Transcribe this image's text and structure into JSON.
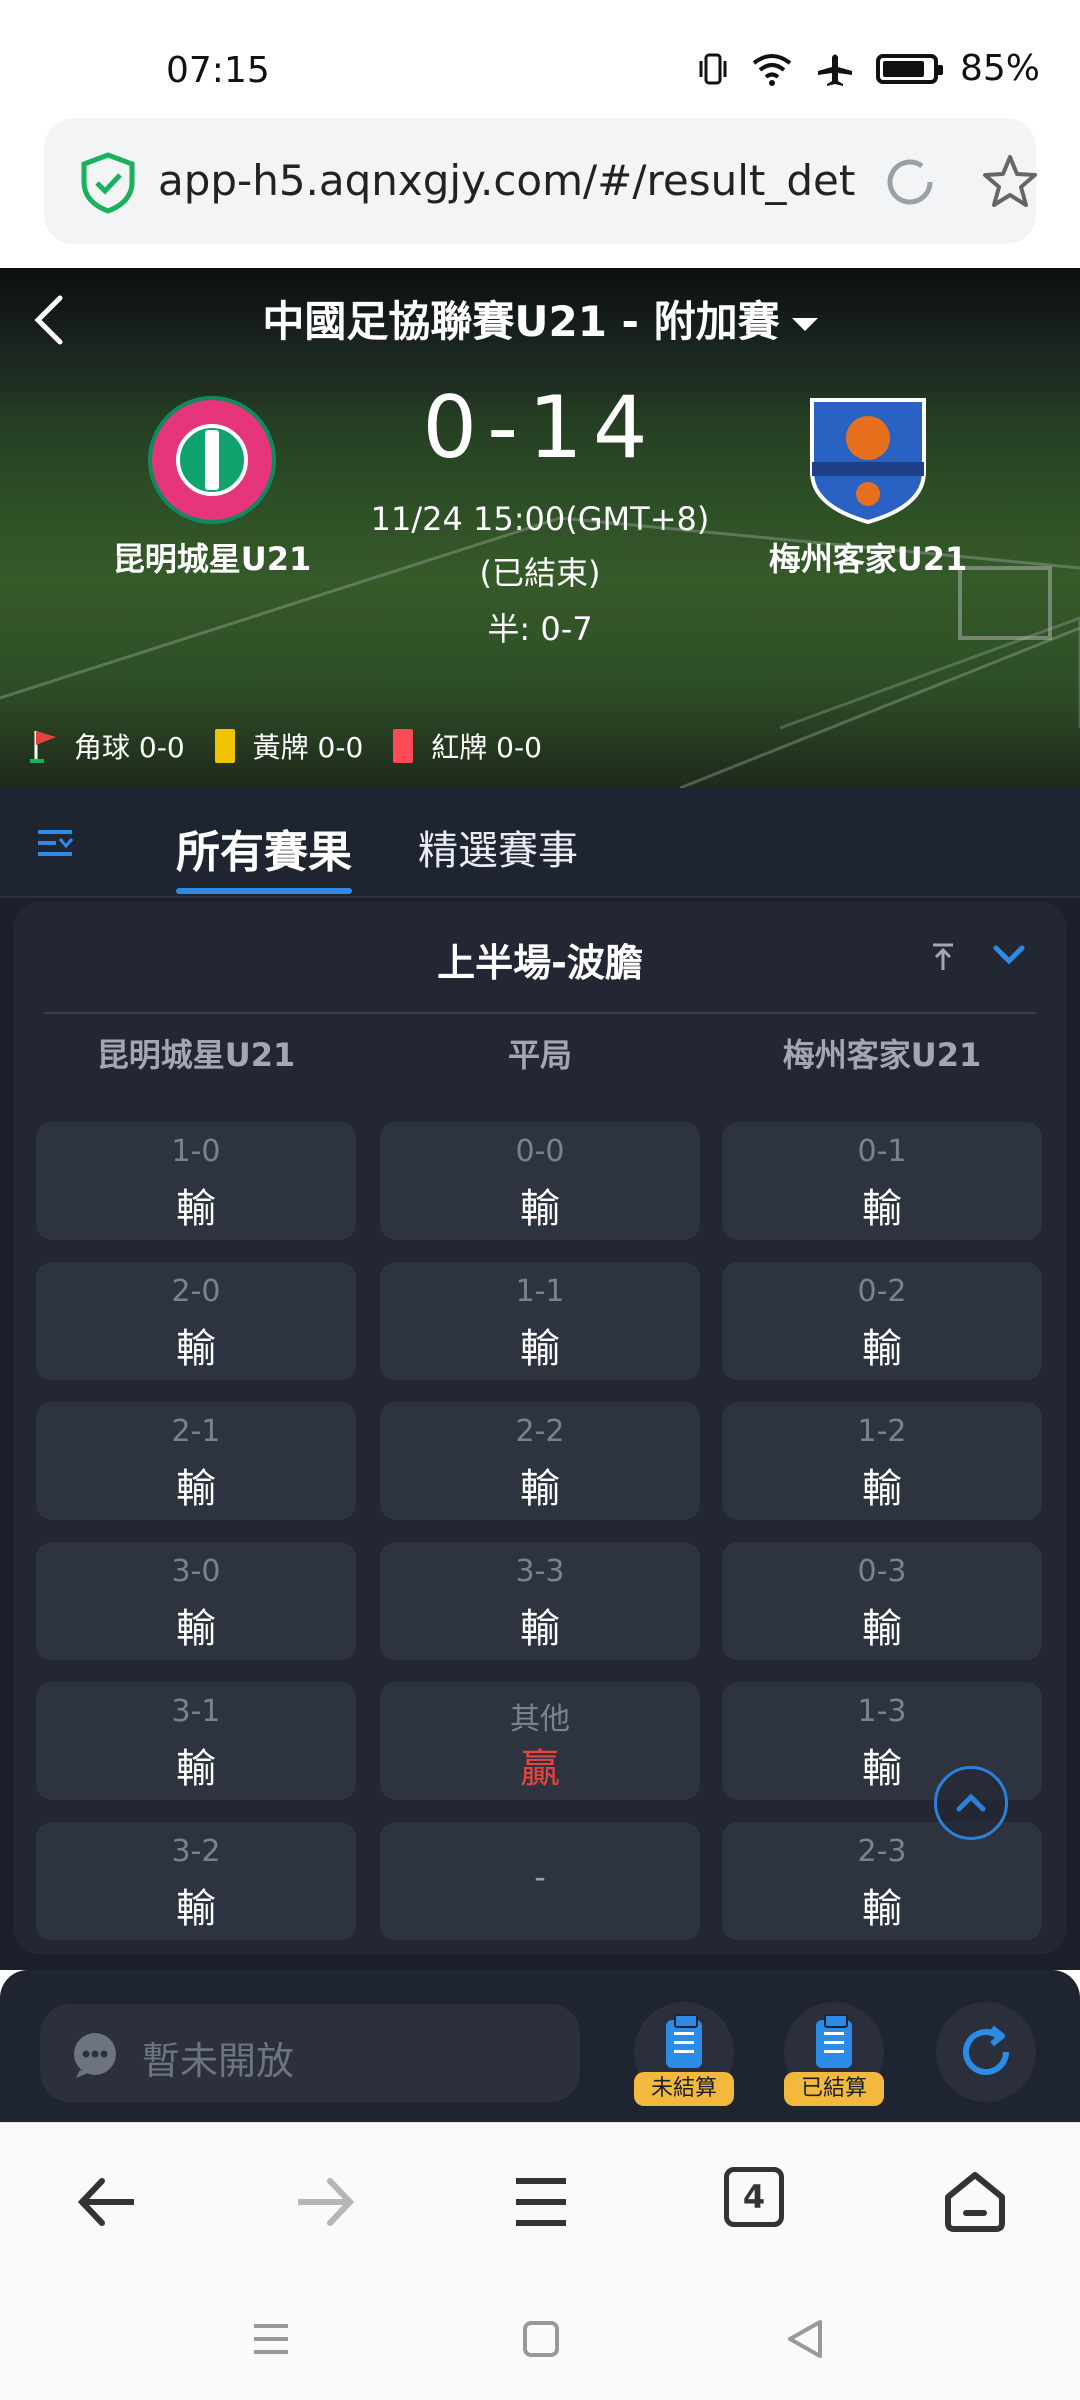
{
  "status_bar": {
    "time": "07:15",
    "battery": "85%"
  },
  "browser": {
    "url": "app-h5.aqnxgjy.com/#/result_det",
    "tab_count": "4"
  },
  "match": {
    "league": "中國足協聯賽U21 - 附加賽",
    "score": "0-14",
    "datetime": "11/24 15:00(GMT+8)",
    "status": "(已結束)",
    "half": "半: 0-7",
    "home": {
      "name": "昆明城星U21"
    },
    "away": {
      "name": "梅州客家U21"
    },
    "corner": "角球 0-0",
    "yellow": "黃牌 0-0",
    "red": "紅牌 0-0"
  },
  "tabs": {
    "all": "所有賽果",
    "featured": "精選賽事"
  },
  "market": {
    "title": "上半場-波膽",
    "col_home": "昆明城星U21",
    "col_draw": "平局",
    "col_away": "梅州客家U21",
    "home": [
      {
        "score": "1-0",
        "result": "輸"
      },
      {
        "score": "2-0",
        "result": "輸"
      },
      {
        "score": "2-1",
        "result": "輸"
      },
      {
        "score": "3-0",
        "result": "輸"
      },
      {
        "score": "3-1",
        "result": "輸"
      },
      {
        "score": "3-2",
        "result": "輸"
      }
    ],
    "draw": [
      {
        "score": "0-0",
        "result": "輸"
      },
      {
        "score": "1-1",
        "result": "輸"
      },
      {
        "score": "2-2",
        "result": "輸"
      },
      {
        "score": "3-3",
        "result": "輸"
      },
      {
        "score": "其他",
        "result": "贏"
      },
      {
        "dash": "-"
      }
    ],
    "away": [
      {
        "score": "0-1",
        "result": "輸"
      },
      {
        "score": "0-2",
        "result": "輸"
      },
      {
        "score": "1-2",
        "result": "輸"
      },
      {
        "score": "0-3",
        "result": "輸"
      },
      {
        "score": "1-3",
        "result": "輸"
      },
      {
        "score": "2-3",
        "result": "輸"
      }
    ]
  },
  "bottom_bar": {
    "chat_placeholder": "暫未開放",
    "unsettled": "未結算",
    "settled": "已結算"
  },
  "colors": {
    "accent": "#2b8be6",
    "win": "#e8433e",
    "panel": "#232733"
  }
}
